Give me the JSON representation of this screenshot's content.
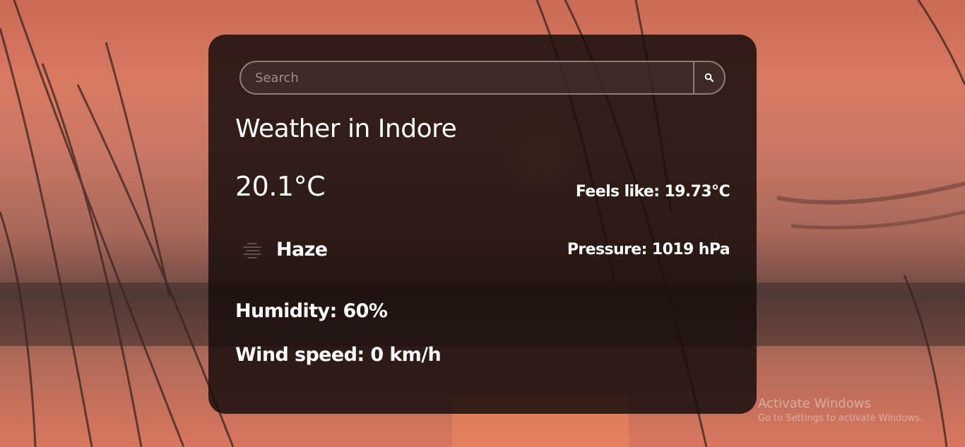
{
  "search": {
    "placeholder": "Search",
    "value": ""
  },
  "weather": {
    "title": "Weather in Indore",
    "temperature": "20.1°C",
    "feels_like": "Feels like: 19.73°C",
    "condition": "Haze",
    "condition_icon": "haze-icon",
    "pressure": "Pressure: 1019 hPa",
    "humidity": "Humidity: 60%",
    "wind_speed": "Wind speed: 0 km/h"
  },
  "watermark": {
    "title": "Activate Windows",
    "subtitle": "Go to Settings to activate Windows."
  },
  "colors": {
    "card_background": "#190e0c",
    "text": "#ffffff",
    "search_border": "#8d7d78",
    "sunset_orange": "#d87a62"
  }
}
